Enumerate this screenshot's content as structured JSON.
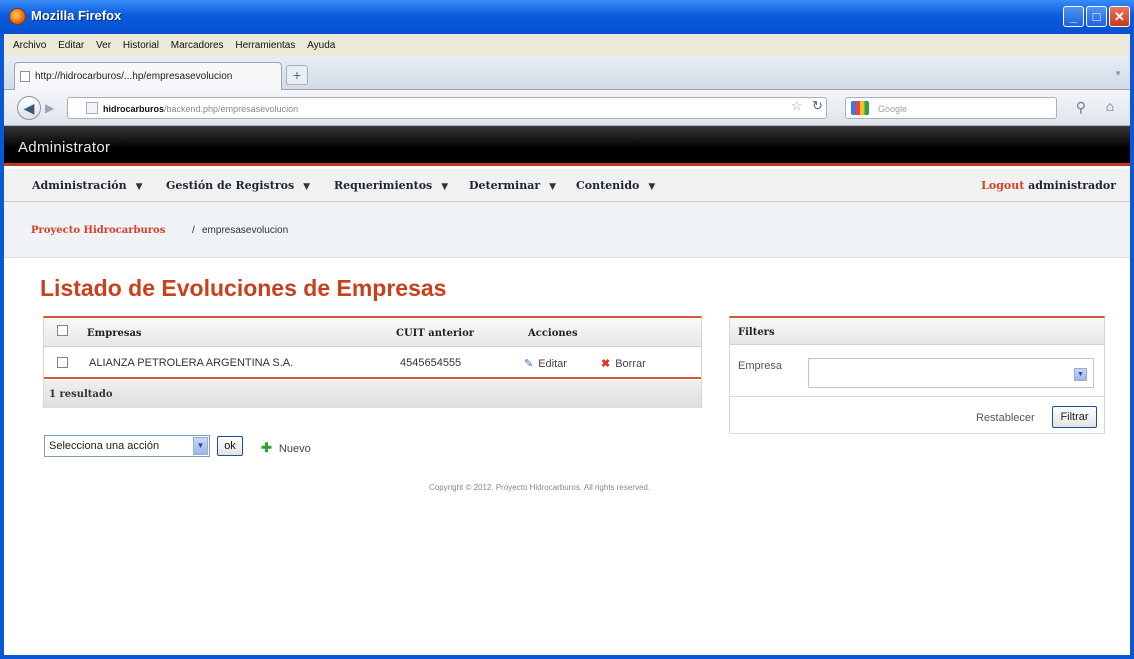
{
  "window": {
    "title": "Mozilla Firefox",
    "min": "_",
    "max": "□",
    "close": "✕"
  },
  "menubar": [
    "Archivo",
    "Editar",
    "Ver",
    "Historial",
    "Marcadores",
    "Herramientas",
    "Ayuda"
  ],
  "tab": {
    "label": "http://hidrocarburos/...hp/empresasevolucion",
    "new_tab": "+"
  },
  "navbar": {
    "url_host": "hidrocarburos",
    "url_path": "/backend.php/empresasevolucion",
    "search_placeholder": "Google"
  },
  "admin": {
    "brand": "Administrator"
  },
  "topnav": {
    "items": [
      "Administración",
      "Gestión de Registros",
      "Requerimientos",
      "Determinar",
      "Contenido"
    ],
    "logout_link": "Logout",
    "user": "administrador"
  },
  "breadcrumb": {
    "root": "Proyecto Hidrocarburos",
    "sep": "/",
    "current": "empresasevolucion"
  },
  "page": {
    "title": "Listado de Evoluciones de Empresas"
  },
  "list": {
    "headers": [
      "Empresas",
      "CUIT anterior",
      "Acciones"
    ],
    "rows": [
      {
        "empresa": "ALIANZA PETROLERA ARGENTINA S.A.",
        "cuit": "4545654555",
        "edit": "Editar",
        "delete": "Borrar"
      }
    ],
    "footer": "1 resultado"
  },
  "actions": {
    "select_value": "Selecciona una acción",
    "ok": "ok",
    "new": "Nuevo"
  },
  "copyright": "Copyright © 2012. Proyecto Hidrocarburos. All rights reserved.",
  "filters": {
    "title": "Filters",
    "empresa_label": "Empresa",
    "empresa_value": "",
    "reset": "Restablecer",
    "submit": "Filtrar"
  },
  "colors": {
    "accent": "#c9401f",
    "titlebar": "#0a5be0",
    "admin_bar": "#000000"
  }
}
